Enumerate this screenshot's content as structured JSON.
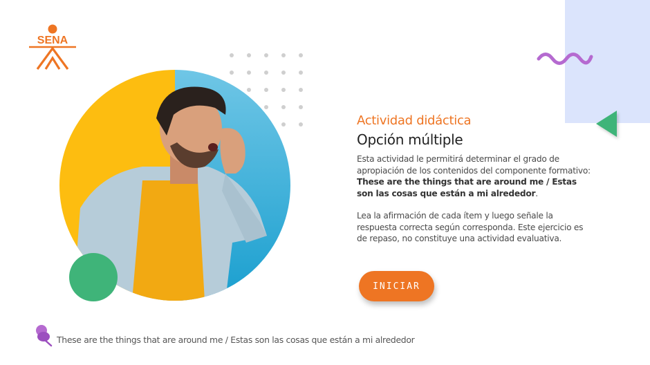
{
  "brand": {
    "logo_text": "SENA",
    "logo_color": "#ee7523"
  },
  "activity": {
    "title": "Actividad didáctica",
    "subtitle": "Opción múltiple",
    "description_lead": "Esta actividad le permitirá determinar el grado de apropiación de los contenidos del componente formativo:",
    "description_topic": "These are the things that are around me /  Estas son las cosas que están a mi alrededor",
    "description_end": ".",
    "instructions": "Lea la afirmación de cada ítem y luego señale la respuesta correcta según corresponda.  Este ejercicio es de repaso, no constituye una actividad evaluativa."
  },
  "start_button": {
    "label": "INICIAR"
  },
  "footer": {
    "text": "These are the things that are around me /  Estas son las cosas que están a mi alrededor",
    "icon": "pin-icon"
  },
  "colors": {
    "accent_orange": "#ee7523",
    "accent_green": "#3fb479",
    "accent_purple": "#b56ad0",
    "panel_blue": "#dbe4fc",
    "circle_yellow": "#fdbd10",
    "circle_blue": "#3fb2dc"
  },
  "illustration": {
    "description_icon": "person-shouting-image"
  }
}
